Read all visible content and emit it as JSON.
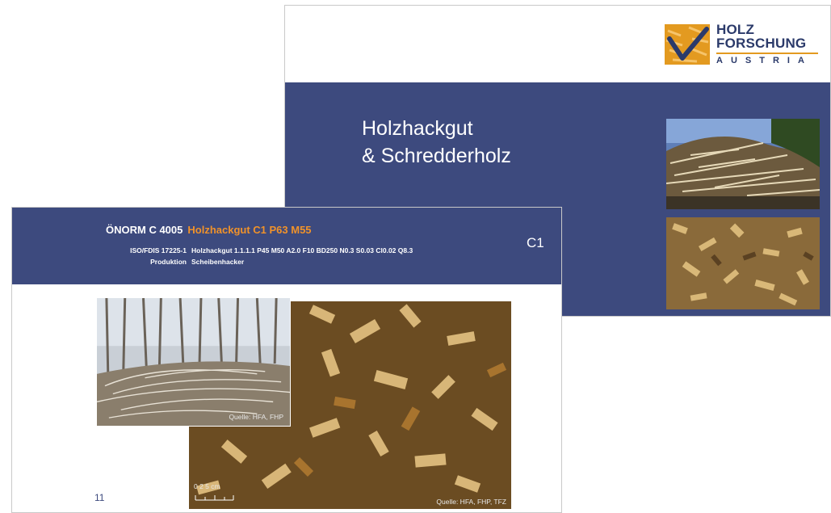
{
  "back_slide": {
    "logo": {
      "line1": "HOLZ",
      "line2": "FORSCHUNG",
      "line3": "AUSTRIA"
    },
    "title_line1": "Holzhackgut",
    "title_line2": "& Schredderholz"
  },
  "front_slide": {
    "norm_label": "ÖNORM C 4005",
    "norm_highlight": "Holzhackgut   C1   P63   M55",
    "iso_label": "ISO/FDIS 17225-1",
    "iso_value": "Holzhackgut   1.1.1.1   P45   M50   A2.0   F10   BD250   N0.3   S0.03   Cl0.02   Q8.3",
    "production_label": "Produktion",
    "production_value": "Scheibenhacker",
    "class_code": "C1",
    "page_number": "11",
    "photo_source_1": "Quelle: HFA, FHP",
    "photo_source_2": "Quelle: HFA, FHP, TFZ",
    "scale_label": "0  2  5   cm"
  },
  "colors": {
    "navy": "#3d4a7e",
    "orange": "#f0922a",
    "logo_orange": "#e39a20"
  }
}
